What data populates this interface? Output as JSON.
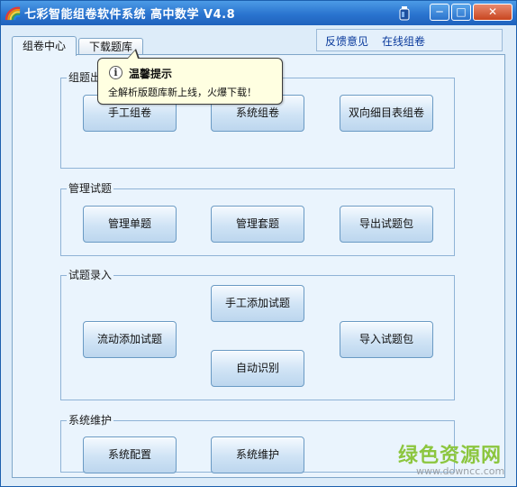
{
  "window": {
    "title": "七彩智能组卷软件系统 高中数学 V4.8",
    "minimize_glyph": "─",
    "maximize_glyph": "□",
    "close_glyph": "✕"
  },
  "tabs": [
    {
      "label": "组卷中心",
      "active": true
    },
    {
      "label": "下载题库",
      "active": false
    }
  ],
  "top_links": {
    "feedback": "反馈意见",
    "online": "在线组卷"
  },
  "groups": {
    "compose": {
      "title": "组题出卷",
      "buttons": [
        "手工组卷",
        "系统组卷",
        "双向细目表组卷"
      ]
    },
    "manage": {
      "title": "管理试题",
      "buttons": [
        "管理单题",
        "管理套题",
        "导出试题包"
      ]
    },
    "entry": {
      "title": "试题录入",
      "buttons": [
        "流动添加试题",
        "手工添加试题",
        "自动识别",
        "导入试题包"
      ]
    },
    "maintain": {
      "title": "系统维护",
      "buttons": [
        "系统配置",
        "系统维护"
      ]
    }
  },
  "tooltip": {
    "icon": "i",
    "title": "温馨提示",
    "text": "全解析版题库新上线，火爆下载！"
  },
  "watermark": {
    "name": "绿色资源网",
    "url": "www.downcc.com"
  },
  "colors": {
    "titlebar": "#2a74cf",
    "link": "#0a3a9c",
    "tooltip_bg": "#ffffe1",
    "watermark": "#8cc63f"
  }
}
